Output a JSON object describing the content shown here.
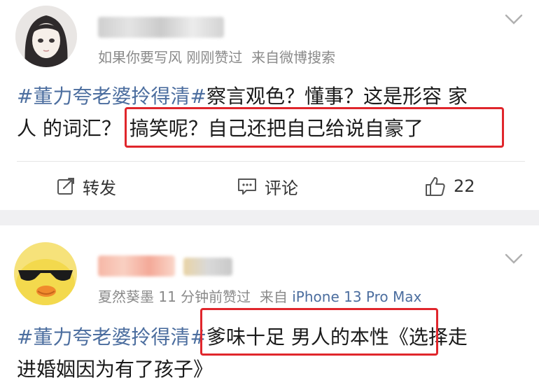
{
  "post1": {
    "meta_text": "如果你要写风 刚刚赞过",
    "source_text": "来自微博搜索",
    "hashtag": "#董力夸老婆拎得清#",
    "line1_rest": "察言观色？懂事？这是形容 家",
    "line2_a": "人 的词汇？",
    "line2_b": "搞笑呢？自己还把自己给说自豪了",
    "actions": {
      "repost_label": "转发",
      "comment_label": "评论",
      "like_count": "22"
    }
  },
  "post2": {
    "meta_text": "夏然葵墨 11 分钟前赞过",
    "source_prefix": "来自",
    "source_device": "iPhone 13 Pro Max",
    "hashtag": "#董力夸老婆拎得清#",
    "line1_box": "爹味十足 男人的本性",
    "line1_rest": "《选择走",
    "line2": "进婚姻因为有了孩子》"
  },
  "colors": {
    "link_blue": "#4c6e9f",
    "highlight_red": "#e0262c",
    "meta_gray": "#8a8a8a",
    "separator_gray": "#f0f0f2"
  },
  "icons": [
    "chevron-down-icon",
    "repost-icon",
    "comment-icon",
    "thumbs-up-icon"
  ]
}
